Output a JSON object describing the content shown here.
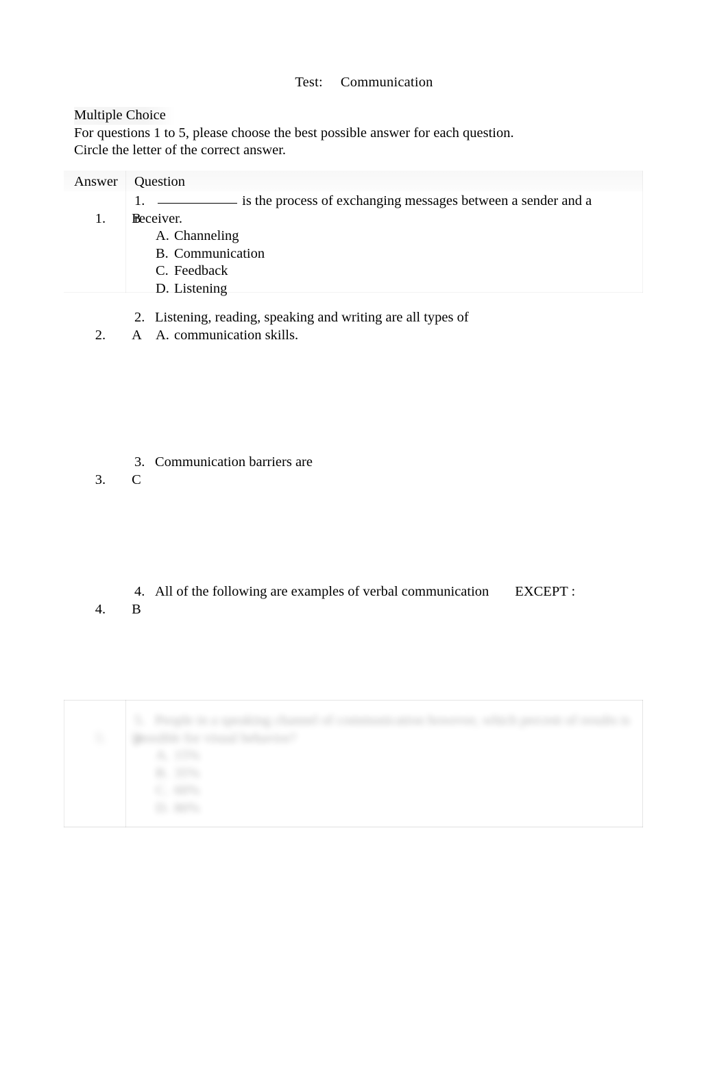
{
  "document": {
    "title": "Test:  Communication",
    "intro": {
      "heading": "Multiple Choice",
      "line1": "For questions 1 to 5, please choose the best possible answer for each question.",
      "line2": "Circle the letter of the correct answer."
    }
  },
  "table": {
    "headers": {
      "answer": "Answer",
      "question": "Question"
    },
    "rows": [
      {
        "answer_number": "1.",
        "answer_letter": "B",
        "q_number": "1.",
        "q_text_before_blank": "",
        "q_text_after_blank": " is the process of exchanging messages between a sender and a receiver.",
        "has_blank": true,
        "options": [
          {
            "letter": "A.",
            "text": "Channeling"
          },
          {
            "letter": "B.",
            "text": "Communication"
          },
          {
            "letter": "C.",
            "text": "Feedback"
          },
          {
            "letter": "D.",
            "text": "Listening"
          }
        ]
      },
      {
        "answer_number": "2.",
        "answer_letter": "A",
        "q_number": "2.",
        "q_text_after_blank": "Listening, reading, speaking and writing are all types of",
        "has_blank": false,
        "options": [
          {
            "letter": "A.",
            "text": "communication skills."
          }
        ]
      },
      {
        "answer_number": "3.",
        "answer_letter": "C",
        "q_number": "3.",
        "q_text_after_blank": "Communication barriers are",
        "has_blank": false,
        "options": []
      },
      {
        "answer_number": "4.",
        "answer_letter": "B",
        "q_number": "4.",
        "q_text_after_blank": "All of the following are examples of verbal communication",
        "q_text_trailing": "EXCEPT :",
        "has_blank": false,
        "options": []
      },
      {
        "answer_number": "5.",
        "answer_letter": "D",
        "q_number": "5.",
        "q_text_after_blank": "People in a speaking channel of communication however, which percent of results is possible for visual behavior?",
        "has_blank": false,
        "blurred": true,
        "options": [
          {
            "letter": "A.",
            "text": "15%"
          },
          {
            "letter": "B.",
            "text": "35%"
          },
          {
            "letter": "C.",
            "text": "60%"
          },
          {
            "letter": "D.",
            "text": "80%"
          }
        ]
      }
    ]
  }
}
